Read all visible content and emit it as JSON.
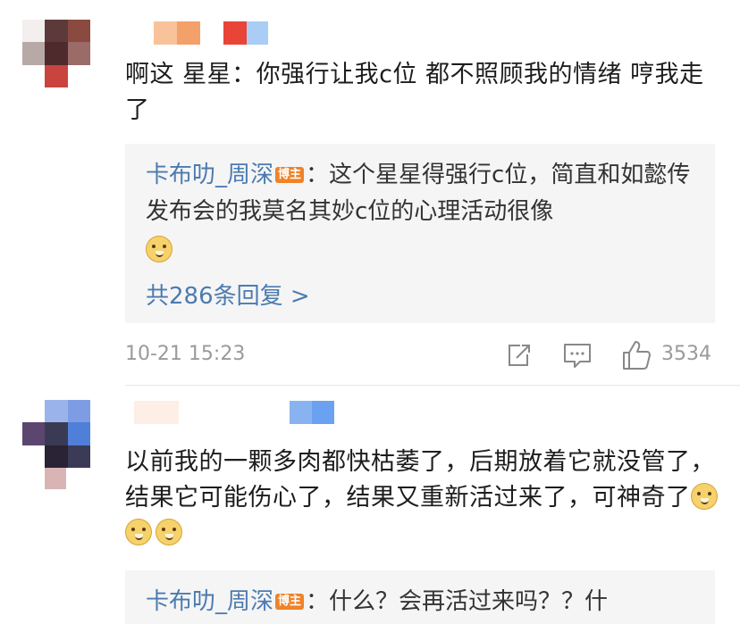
{
  "comments": [
    {
      "text": "啊这 星星：你强行让我c位 都不照顾我的情绪 哼我走了",
      "reply": {
        "author": "卡布叻_周深",
        "badge": "博主",
        "text": "：这个星星得强行c位，简直和如懿传发布会的我莫名其妙c位的心理活动很像",
        "emoji": "doge-emoji",
        "more_label": "共286条回复 >"
      },
      "timestamp": "10-21 15:23",
      "likes": "3534",
      "icons": [
        "share-icon",
        "comment-icon",
        "like-icon"
      ]
    },
    {
      "text": "以前我的一颗多肉都快枯萎了，后期放着它就没管了，结果它可能伤心了，结果又重新活过来了，可神奇了",
      "emoji_count": 3,
      "reply": {
        "author": "卡布叻_周深",
        "badge": "博主",
        "text": "：什么？会再活过来吗？？什"
      }
    }
  ],
  "colors": {
    "link": "#4c7bb0",
    "badge": "#f08228",
    "reply_bg": "#f5f5f5",
    "meta_text": "#9a9a9a"
  }
}
